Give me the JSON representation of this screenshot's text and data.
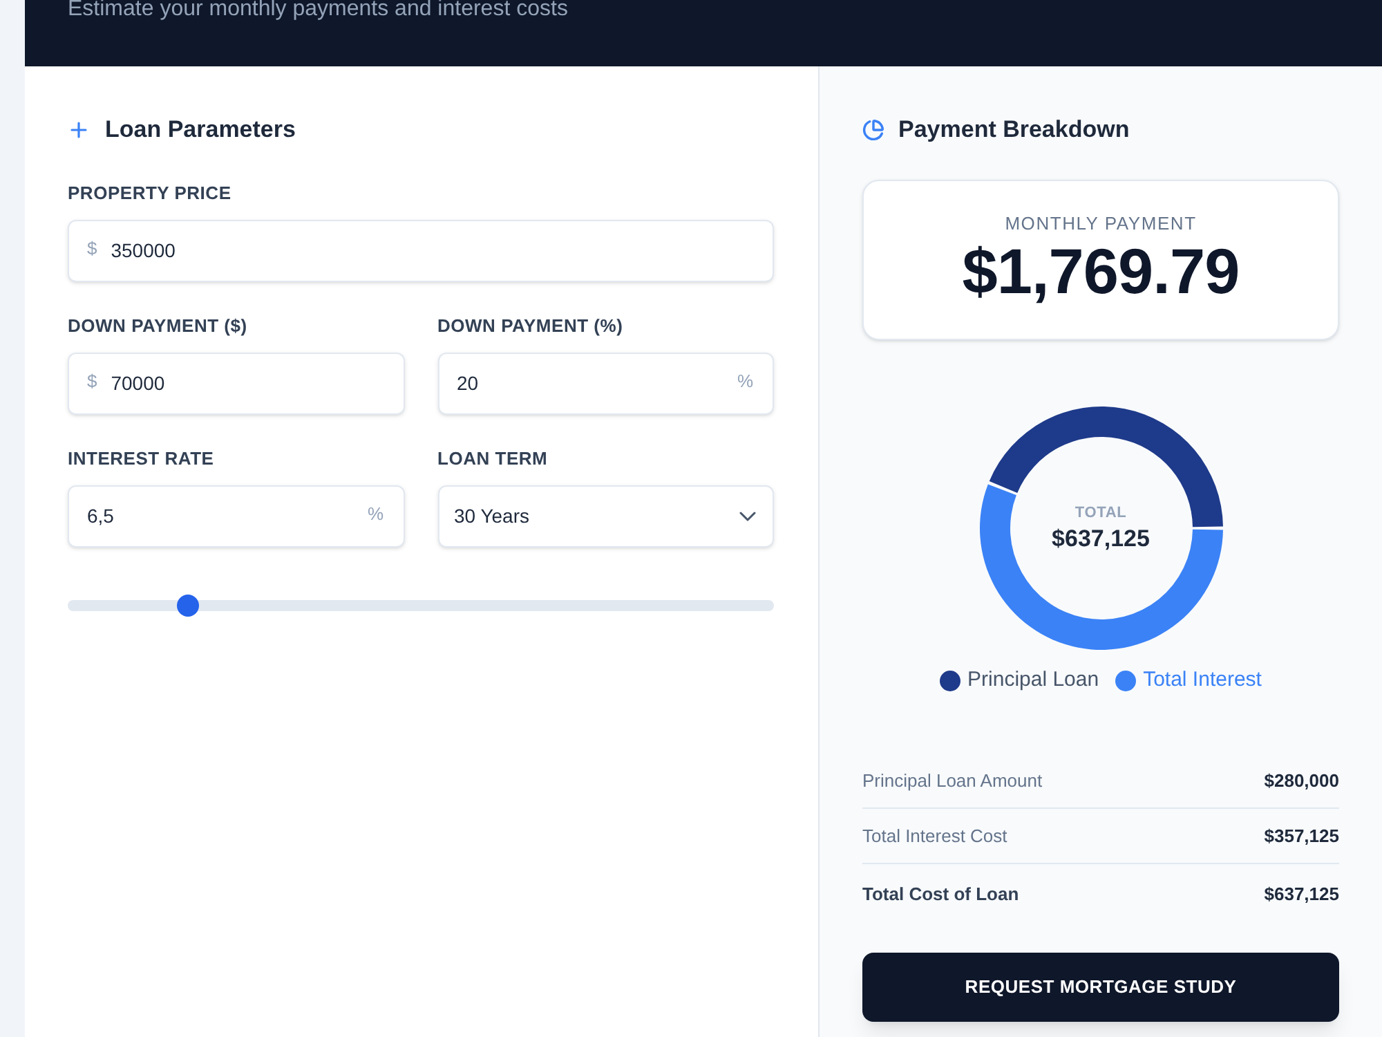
{
  "header": {
    "subtitle": "Estimate your monthly payments and interest costs"
  },
  "loan_parameters": {
    "title": "Loan Parameters",
    "rows": [
      [
        {
          "kind": "input",
          "label": "PROPERTY PRICE",
          "prefix": "$",
          "value": "350000"
        }
      ],
      [
        {
          "kind": "input",
          "label": "DOWN PAYMENT ($)",
          "prefix": "$",
          "value": "70000"
        },
        {
          "kind": "input",
          "label": "DOWN PAYMENT (%)",
          "value": "20",
          "suffix": "%"
        }
      ],
      [
        {
          "kind": "input",
          "label": "INTEREST RATE",
          "value": "6,5",
          "suffix": "%"
        },
        {
          "kind": "select",
          "label": "LOAN TERM",
          "value": "30 Years"
        }
      ]
    ],
    "slider": {
      "level": 0.17
    }
  },
  "payment_breakdown": {
    "title": "Payment Breakdown",
    "monthly_payment": {
      "label": "MONTHLY PAYMENT",
      "amount": "$1,769.79"
    },
    "donut": {
      "center_label": "TOTAL",
      "center_value": "$637,125",
      "chart_data": {
        "type": "donut",
        "categories": [
          "Principal Loan",
          "Total Interest"
        ],
        "values": [
          43.9,
          56.1
        ],
        "legend": "bottom"
      },
      "legend_entries": [
        {
          "color": "#1e3a8a",
          "highlighted": false
        },
        {
          "color": "#3b82f6",
          "highlighted": true
        }
      ]
    },
    "summary": [
      {
        "kind": "item",
        "label": "Principal Loan Amount",
        "value": "$280,000"
      },
      {
        "kind": "item",
        "label": "Total Interest Cost",
        "value": "$357,125"
      },
      {
        "kind": "total",
        "label": "Total Cost of Loan",
        "value": "$637,125"
      }
    ],
    "button": "REQUEST MORTGAGE STUDY"
  }
}
